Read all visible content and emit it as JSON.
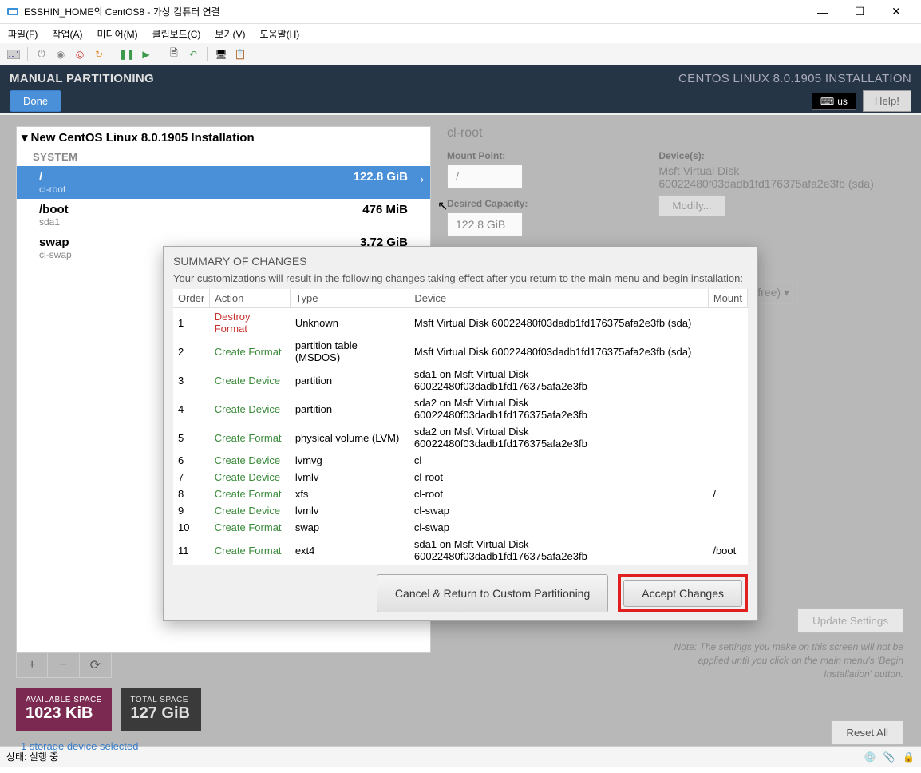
{
  "window": {
    "title": "ESSHIN_HOME의 CentOS8 - 가상 컴퓨터 연결"
  },
  "menus": {
    "file": "파일(F)",
    "action": "작업(A)",
    "media": "미디어(M)",
    "clipboard": "클립보드(C)",
    "view": "보기(V)",
    "help": "도움말(H)"
  },
  "header": {
    "title": "MANUAL PARTITIONING",
    "done": "Done",
    "install_title": "CENTOS LINUX 8.0.1905 INSTALLATION",
    "kbd": "us",
    "help": "Help!"
  },
  "tree": {
    "title": "New CentOS Linux 8.0.1905 Installation",
    "section": "SYSTEM",
    "rows": [
      {
        "mp": "/",
        "dev": "cl-root",
        "size": "122.8 GiB"
      },
      {
        "mp": "/boot",
        "dev": "sda1",
        "size": "476 MiB"
      },
      {
        "mp": "swap",
        "dev": "cl-swap",
        "size": "3.72 GiB"
      }
    ]
  },
  "detail": {
    "title": "cl-root",
    "mount_label": "Mount Point:",
    "mount_value": "/",
    "capacity_label": "Desired Capacity:",
    "capacity_value": "122.8 GiB",
    "devices_label": "Device(s):",
    "device_name": "Msft Virtual Disk",
    "device_id": "60022480f03dadb1fd176375afa2e3fb (sda)",
    "modify": "Modify...",
    "vol_text": "(0 B free)"
  },
  "dialog": {
    "title": "SUMMARY OF CHANGES",
    "subtitle": "Your customizations will result in the following changes taking effect after you return to the main menu and begin installation:",
    "headers": {
      "order": "Order",
      "action": "Action",
      "type": "Type",
      "device": "Device",
      "mount": "Mount"
    },
    "rows": [
      {
        "o": "1",
        "a": "Destroy Format",
        "cls": "destroy",
        "t": "Unknown",
        "d": "Msft Virtual Disk 60022480f03dadb1fd176375afa2e3fb (sda)",
        "m": ""
      },
      {
        "o": "2",
        "a": "Create Format",
        "cls": "create",
        "t": "partition table (MSDOS)",
        "d": "Msft Virtual Disk 60022480f03dadb1fd176375afa2e3fb (sda)",
        "m": ""
      },
      {
        "o": "3",
        "a": "Create Device",
        "cls": "create",
        "t": "partition",
        "d": "sda1 on Msft Virtual Disk 60022480f03dadb1fd176375afa2e3fb",
        "m": ""
      },
      {
        "o": "4",
        "a": "Create Device",
        "cls": "create",
        "t": "partition",
        "d": "sda2 on Msft Virtual Disk 60022480f03dadb1fd176375afa2e3fb",
        "m": ""
      },
      {
        "o": "5",
        "a": "Create Format",
        "cls": "create",
        "t": "physical volume (LVM)",
        "d": "sda2 on Msft Virtual Disk 60022480f03dadb1fd176375afa2e3fb",
        "m": ""
      },
      {
        "o": "6",
        "a": "Create Device",
        "cls": "create",
        "t": "lvmvg",
        "d": "cl",
        "m": ""
      },
      {
        "o": "7",
        "a": "Create Device",
        "cls": "create",
        "t": "lvmlv",
        "d": "cl-root",
        "m": ""
      },
      {
        "o": "8",
        "a": "Create Format",
        "cls": "create",
        "t": "xfs",
        "d": "cl-root",
        "m": "/"
      },
      {
        "o": "9",
        "a": "Create Device",
        "cls": "create",
        "t": "lvmlv",
        "d": "cl-swap",
        "m": ""
      },
      {
        "o": "10",
        "a": "Create Format",
        "cls": "create",
        "t": "swap",
        "d": "cl-swap",
        "m": ""
      },
      {
        "o": "11",
        "a": "Create Format",
        "cls": "create",
        "t": "ext4",
        "d": "sda1 on Msft Virtual Disk 60022480f03dadb1fd176375afa2e3fb",
        "m": "/boot"
      }
    ],
    "cancel": "Cancel & Return to Custom Partitioning",
    "accept": "Accept Changes"
  },
  "space": {
    "avail_label": "AVAILABLE SPACE",
    "avail_value": "1023 KiB",
    "total_label": "TOTAL SPACE",
    "total_value": "127 GiB"
  },
  "storage_link": "1 storage device selected",
  "update": "Update Settings",
  "note": "Note:  The settings you make on this screen will not be applied until you click on the main menu's 'Begin Installation' button.",
  "reset": "Reset All",
  "status": "상태: 실행 중"
}
